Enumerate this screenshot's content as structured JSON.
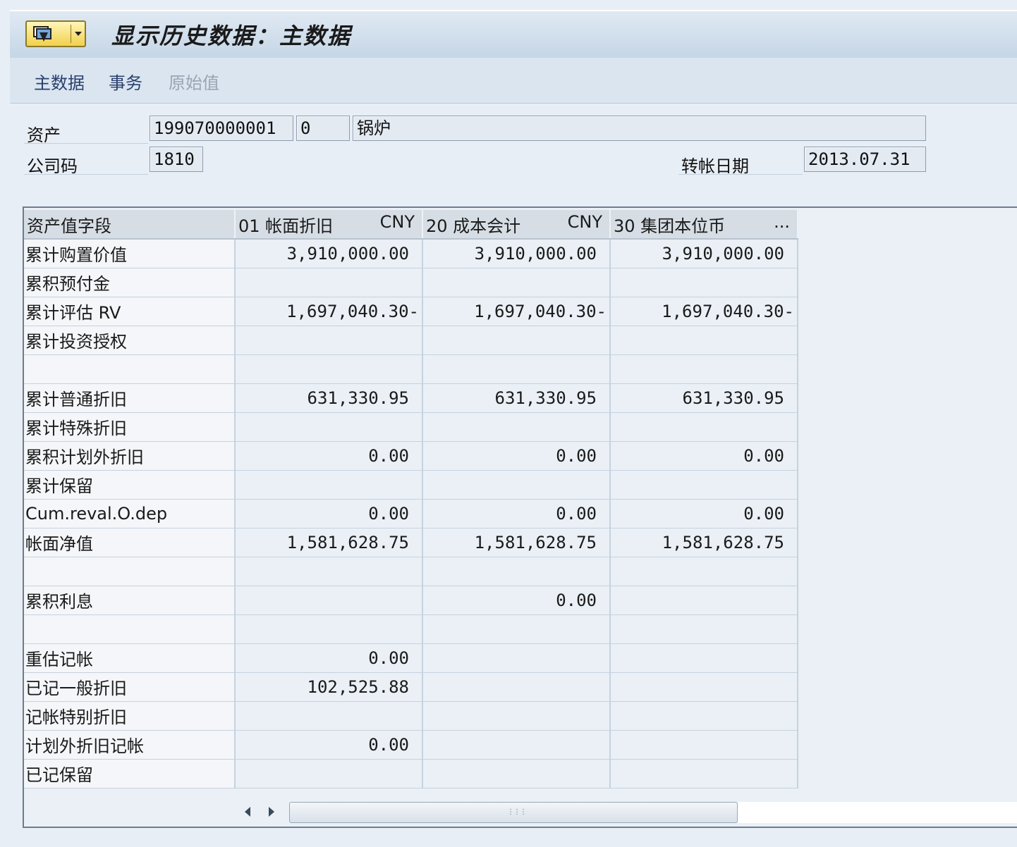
{
  "window": {
    "title": "显示历史数据：主数据"
  },
  "toolbar": {
    "items": [
      {
        "label": "主数据",
        "enabled": true
      },
      {
        "label": "事务",
        "enabled": true
      },
      {
        "label": "原始值",
        "enabled": false
      }
    ]
  },
  "header": {
    "asset_label": "资产",
    "asset_number": "199070000001",
    "sub_number": "0",
    "asset_description": "锅炉",
    "company_label": "公司码",
    "company_code": "1810",
    "posting_date_label": "转帐日期",
    "posting_date": "2013.07.31"
  },
  "table": {
    "columns": [
      {
        "label": "资产值字段",
        "currency": ""
      },
      {
        "label": "01 帐面折旧",
        "currency": "CNY"
      },
      {
        "label": "20 成本会计",
        "currency": "CNY"
      },
      {
        "label": "30 集团本位币",
        "currency": "..."
      }
    ],
    "rows": [
      {
        "field": "累计购置价值",
        "values": [
          "3,910,000.00",
          "3,910,000.00",
          "3,910,000.00"
        ]
      },
      {
        "field": "累积预付金",
        "values": [
          "",
          "",
          ""
        ]
      },
      {
        "field": "累计评估    RV",
        "values": [
          "1,697,040.30-",
          "1,697,040.30-",
          "1,697,040.30-"
        ]
      },
      {
        "field": "累计投资授权",
        "values": [
          "",
          "",
          ""
        ]
      },
      {
        "field": "",
        "values": [
          "",
          "",
          ""
        ]
      },
      {
        "field": "累计普通折旧",
        "values": [
          "631,330.95",
          "631,330.95",
          "631,330.95"
        ]
      },
      {
        "field": "累计特殊折旧",
        "values": [
          "",
          "",
          ""
        ]
      },
      {
        "field": "累积计划外折旧",
        "values": [
          "0.00",
          "0.00",
          "0.00"
        ]
      },
      {
        "field": "累计保留",
        "values": [
          "",
          "",
          ""
        ]
      },
      {
        "field": "Cum.reval.O.dep",
        "values": [
          "0.00",
          "0.00",
          "0.00"
        ]
      },
      {
        "field": "帐面净值",
        "values": [
          "1,581,628.75",
          "1,581,628.75",
          "1,581,628.75"
        ]
      },
      {
        "field": "",
        "values": [
          "",
          "",
          ""
        ]
      },
      {
        "field": "累积利息",
        "values": [
          "",
          "0.00",
          ""
        ]
      },
      {
        "field": "",
        "values": [
          "",
          "",
          ""
        ]
      },
      {
        "field": "重估记帐",
        "values": [
          "0.00",
          "",
          ""
        ]
      },
      {
        "field": "已记一般折旧",
        "values": [
          "102,525.88",
          "",
          ""
        ]
      },
      {
        "field": "记帐特别折旧",
        "values": [
          "",
          "",
          ""
        ]
      },
      {
        "field": "计划外折旧记帐",
        "values": [
          "0.00",
          "",
          ""
        ]
      },
      {
        "field": "已记保留",
        "values": [
          "",
          "",
          ""
        ]
      }
    ]
  },
  "icons": {
    "menu": "sap-menu-icon",
    "scroll_left": "arrow-left-icon",
    "scroll_right": "arrow-right-icon",
    "grip": "grip-icon"
  }
}
